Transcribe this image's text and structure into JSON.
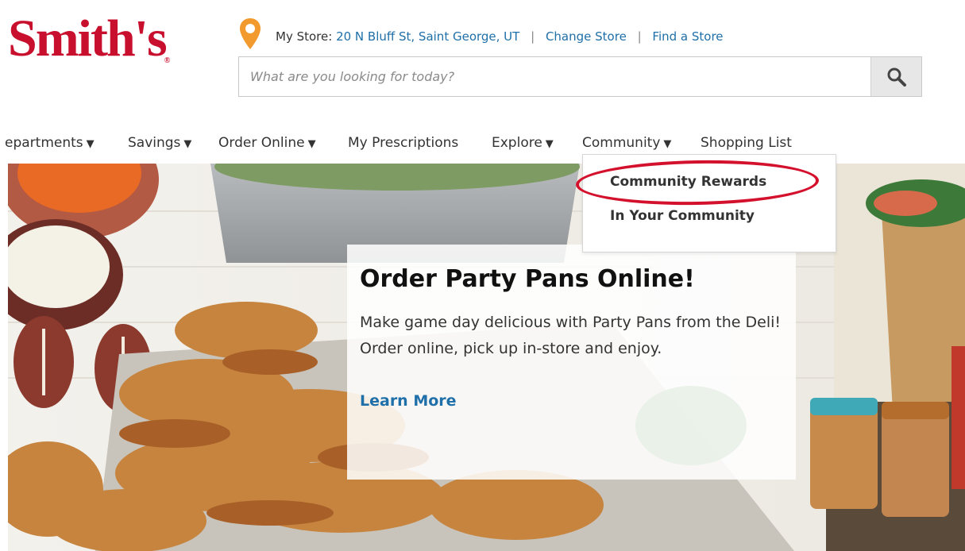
{
  "logo": {
    "text": "Smith's",
    "mark": "®"
  },
  "store": {
    "label": "My Store:",
    "address": "20 N Bluff St, Saint George, UT",
    "change_store": "Change Store",
    "find_store": "Find a Store"
  },
  "search": {
    "placeholder": "What are you looking for today?",
    "value": ""
  },
  "nav": {
    "departments": "epartments",
    "savings": "Savings",
    "order_online": "Order Online",
    "prescriptions": "My Prescriptions",
    "explore": "Explore",
    "community": "Community",
    "shopping_list": "Shopping List",
    "arrow": "▼"
  },
  "dropdown": {
    "items": [
      {
        "label": "Community Rewards"
      },
      {
        "label": "In Your Community"
      }
    ]
  },
  "promo": {
    "title": "Order Party Pans Online!",
    "body": "Make game day delicious with Party Pans from the Deli! Order online, pick up in-store and enjoy.",
    "link": "Learn More"
  },
  "colors": {
    "brand": "#c8102e",
    "link": "#1f6fa8",
    "annotation": "#d4112c"
  }
}
